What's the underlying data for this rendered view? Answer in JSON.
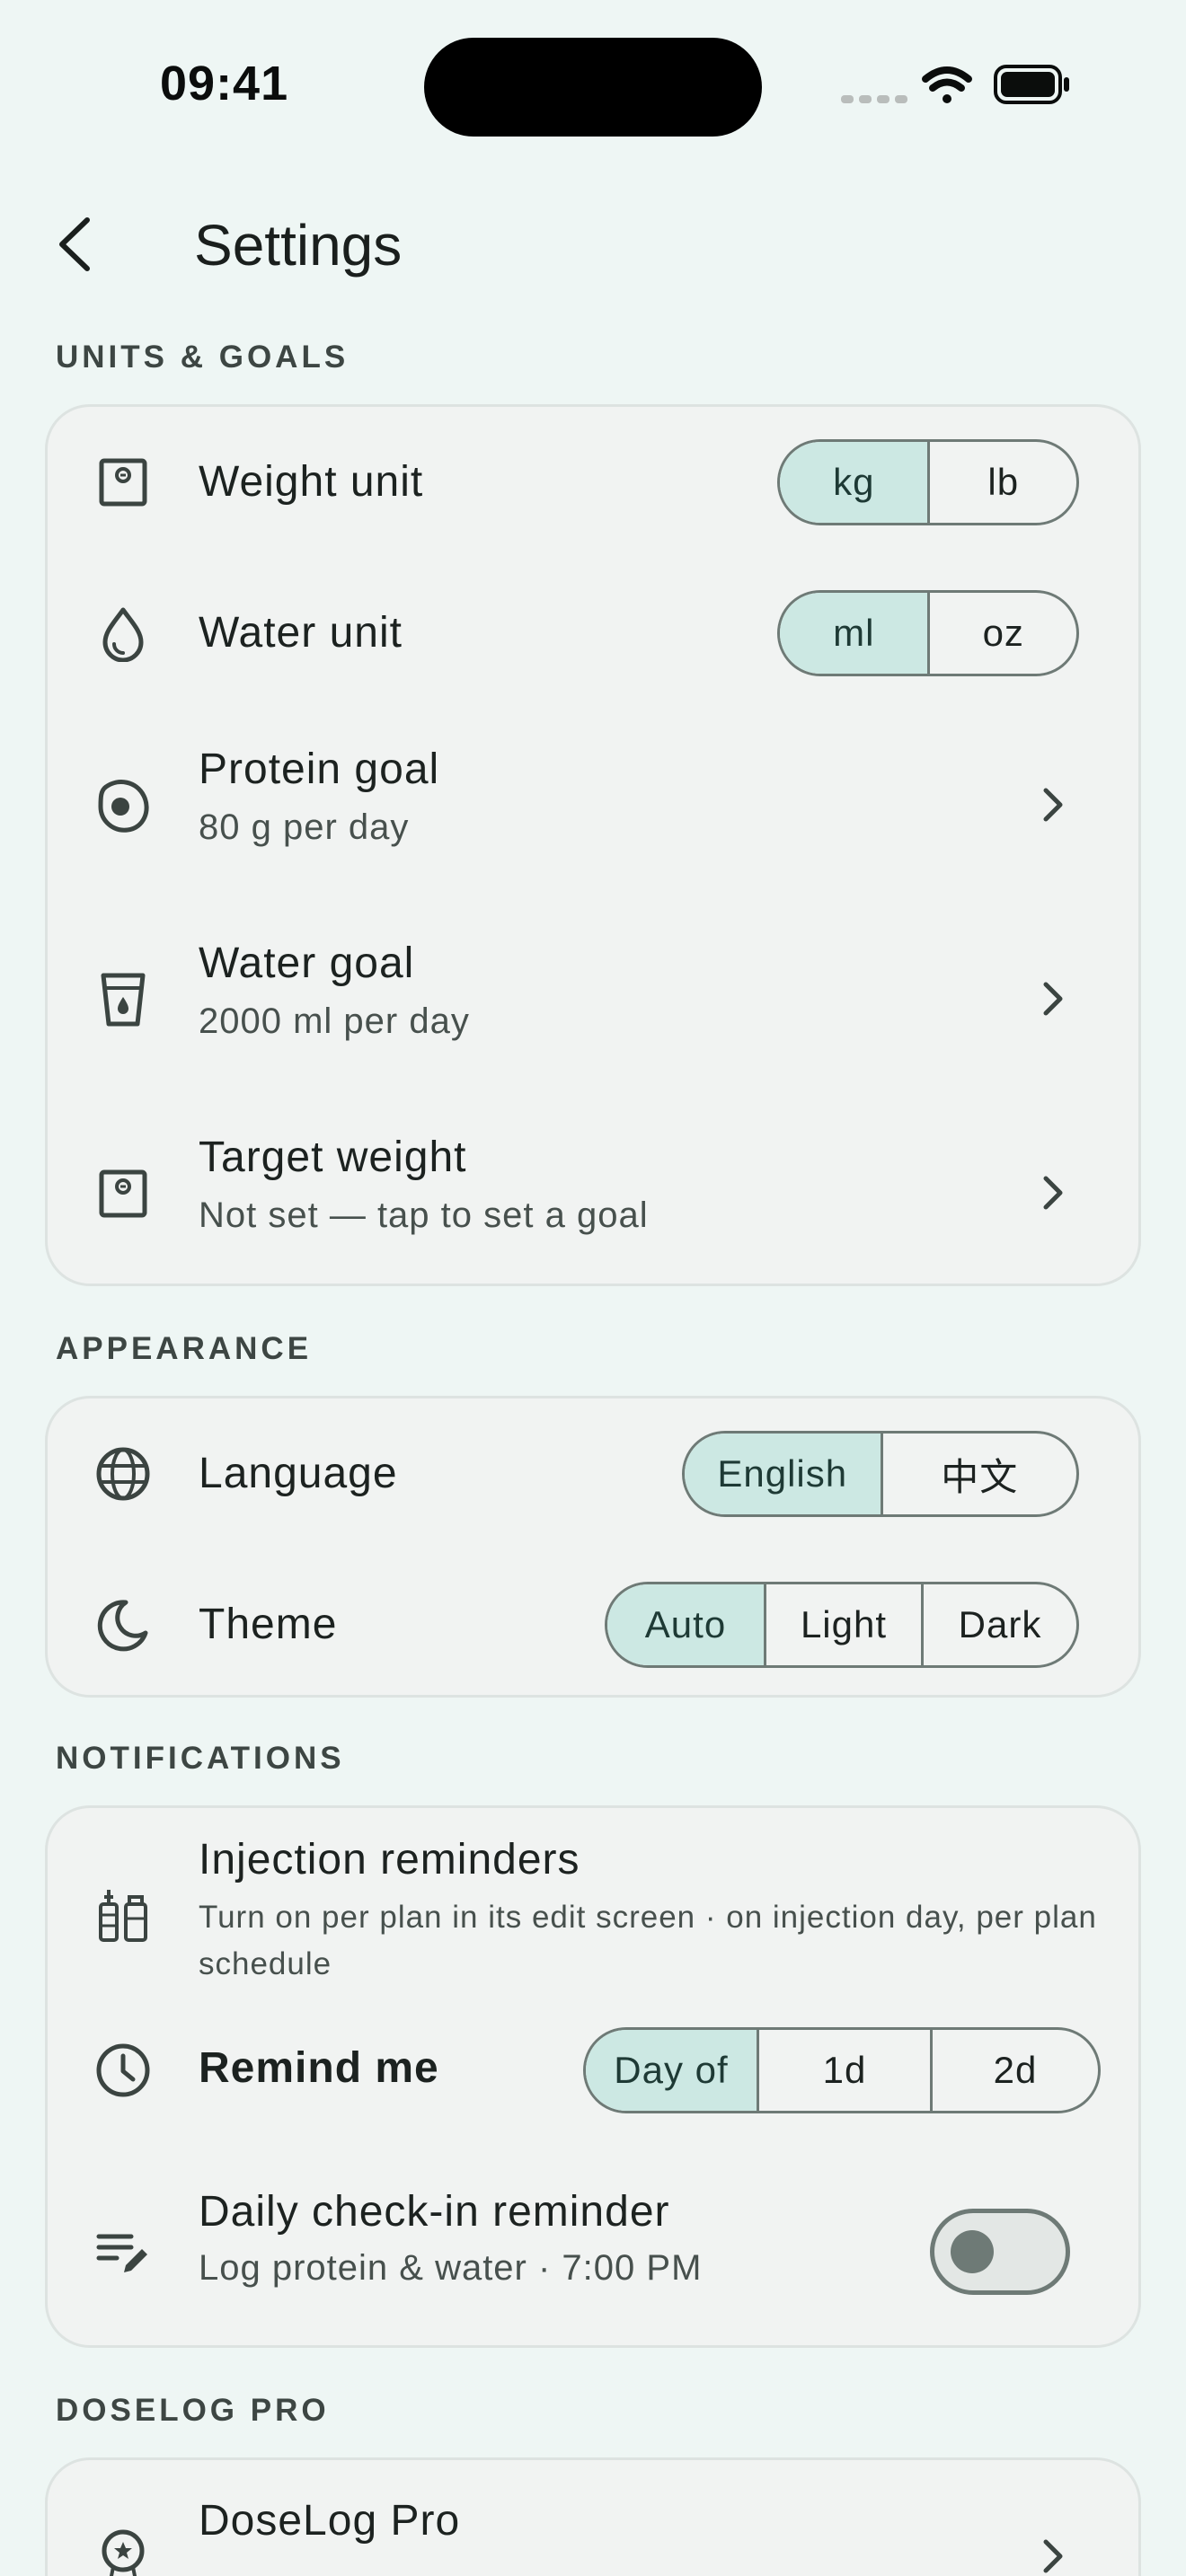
{
  "status_bar": {
    "time": "09:41"
  },
  "header": {
    "title": "Settings"
  },
  "units_goals": {
    "label": "UNITS & GOALS",
    "weight_unit": {
      "label": "Weight unit",
      "options": [
        "kg",
        "lb"
      ],
      "selected": "kg"
    },
    "water_unit": {
      "label": "Water unit",
      "options": [
        "ml",
        "oz"
      ],
      "selected": "ml"
    },
    "protein_goal": {
      "label": "Protein goal",
      "value": "80 g per day"
    },
    "water_goal": {
      "label": "Water goal",
      "value": "2000 ml per day"
    },
    "target_weight": {
      "label": "Target weight",
      "value": "Not set — tap to set a goal"
    }
  },
  "appearance": {
    "label": "APPEARANCE",
    "language": {
      "label": "Language",
      "options": [
        "English",
        "中文"
      ],
      "selected": "English"
    },
    "theme": {
      "label": "Theme",
      "options": [
        "Auto",
        "Light",
        "Dark"
      ],
      "selected": "Auto"
    }
  },
  "notifications": {
    "label": "NOTIFICATIONS",
    "injection": {
      "label": "Injection reminders",
      "description": "Turn on per plan in its edit screen · on injection day, per plan schedule"
    },
    "remind_me": {
      "label": "Remind me",
      "options": [
        "Day of",
        "1d",
        "2d"
      ],
      "selected": "Day of"
    },
    "daily_checkin": {
      "label": "Daily check-in reminder",
      "value": "Log protein & water · 7:00 PM",
      "enabled": false
    }
  },
  "doselog_pro": {
    "label": "DOSELOG PRO",
    "item": {
      "label": "DoseLog Pro"
    }
  },
  "colors": {
    "accent": "#cce8e3",
    "background": "#eef6f4",
    "card": "#f1f3f2",
    "outline": "#6e7a76"
  }
}
